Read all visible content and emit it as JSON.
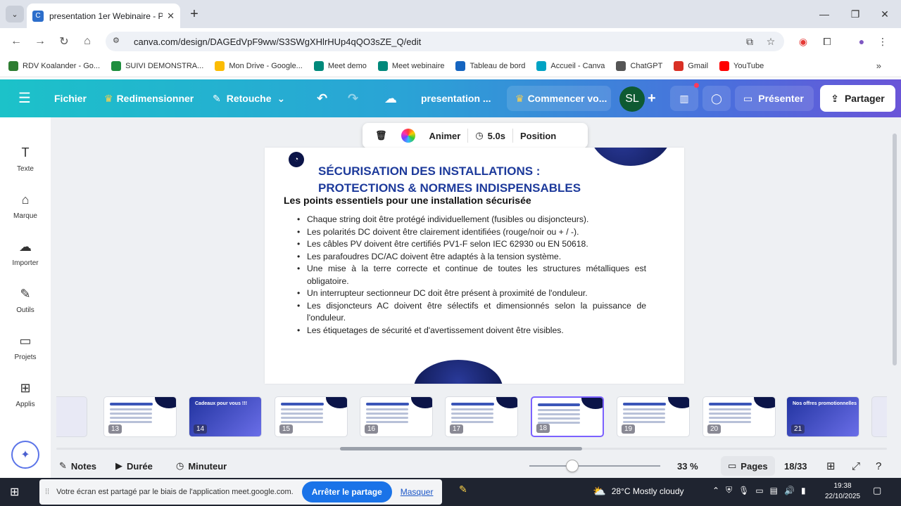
{
  "browser": {
    "tab_title": "presentation 1er Webinaire - P",
    "tab_close": "✕",
    "new_tab": "+",
    "url": "canva.com/design/DAGEdVpF9ww/S3SWgXHlrHUp4qQO3sZE_Q/edit",
    "bookmarks": [
      {
        "label": "RDV Koalander - Go...",
        "color": "#2e7d32"
      },
      {
        "label": "SUIVI DEMONSTRA...",
        "color": "#1e8e3e"
      },
      {
        "label": "Mon Drive - Google...",
        "color": "#fbbc04"
      },
      {
        "label": "Meet demo",
        "color": "#00897b"
      },
      {
        "label": "Meet webinaire",
        "color": "#00897b"
      },
      {
        "label": "Tableau de bord",
        "color": "#1565c0"
      },
      {
        "label": "Accueil - Canva",
        "color": "#00a3c4"
      },
      {
        "label": "ChatGPT",
        "color": "#555555"
      },
      {
        "label": "Gmail",
        "color": "#d93025"
      },
      {
        "label": "YouTube",
        "color": "#ff0000"
      }
    ],
    "bookmarks_more": "»"
  },
  "canva": {
    "menu_icon": "☰",
    "file": "Fichier",
    "resize": "Redimensionner",
    "retouch": "Retouche",
    "doc_title": "presentation ...",
    "start": "Commencer vo...",
    "avatar_initials": "SL",
    "add": "+",
    "present": "Présenter",
    "share": "Partager",
    "accent": "#7b61ff"
  },
  "float_toolbar": {
    "animate": "Animer",
    "duration": "5.0s",
    "position": "Position"
  },
  "rail": [
    {
      "label": "Texte",
      "icon": "T"
    },
    {
      "label": "Marque",
      "icon": "⌂"
    },
    {
      "label": "Importer",
      "icon": "☁"
    },
    {
      "label": "Outils",
      "icon": "✎"
    },
    {
      "label": "Projets",
      "icon": "▭"
    },
    {
      "label": "Applis",
      "icon": "⊞"
    }
  ],
  "slide": {
    "title_line1": "SÉCURISATION DES INSTALLATIONS :",
    "title_line2": "PROTECTIONS & NORMES INDISPENSABLES",
    "subtitle": "Les points essentiels pour une installation sécurisée",
    "bullets": [
      "Chaque string doit être protégé individuellement (fusibles ou disjoncteurs).",
      "Les polarités DC doivent être clairement identifiées (rouge/noir ou + / -).",
      "Les câbles PV doivent être certifiés PV1-F selon IEC 62930 ou EN 50618.",
      "Les parafoudres DC/AC doivent être adaptés à la tension système.",
      "Une mise à la terre correcte et continue de toutes les structures métalliques est obligatoire.",
      "Un interrupteur sectionneur DC doit être présent à proximité de l'onduleur.",
      "Les disjoncteurs AC doivent être sélectifs et dimensionnés selon la puissance de l'onduleur.",
      "Les étiquetages de sécurité et d'avertissement doivent être visibles."
    ]
  },
  "thumbnails": [
    {
      "num": "",
      "kind": "partial-left"
    },
    {
      "num": "13",
      "kind": "light"
    },
    {
      "num": "14",
      "kind": "dark",
      "title": "Cadeaux pour vous !!!"
    },
    {
      "num": "15",
      "kind": "light"
    },
    {
      "num": "16",
      "kind": "light"
    },
    {
      "num": "17",
      "kind": "light"
    },
    {
      "num": "18",
      "kind": "active"
    },
    {
      "num": "19",
      "kind": "light"
    },
    {
      "num": "20",
      "kind": "light"
    },
    {
      "num": "21",
      "kind": "dark",
      "title": "Nos offres promotionnelles"
    },
    {
      "num": "",
      "kind": "partial"
    }
  ],
  "bottom": {
    "notes": "Notes",
    "duration": "Durée",
    "timer": "Minuteur",
    "zoom": "33 %",
    "zoom_level": 0.33,
    "pages": "Pages",
    "page_count": "18/33"
  },
  "taskbar": {
    "share_notice": "Votre écran est partagé par le biais de l'application meet.google.com.",
    "stop_share": "Arrêter le partage",
    "hide": "Masquer",
    "weather": "28°C  Mostly cloudy",
    "time": "19:38",
    "date": "22/10/2025"
  }
}
